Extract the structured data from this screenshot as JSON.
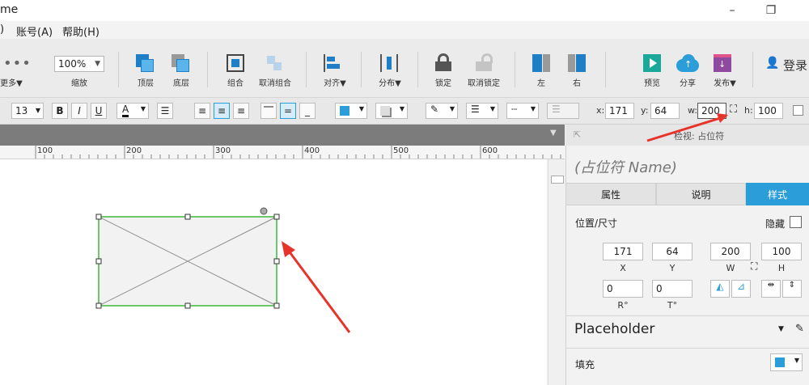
{
  "window": {
    "title": "me",
    "minimize": "–",
    "restore": "❐"
  },
  "menu": {
    "items": [
      "(A) 账号(A)",
      "帮助(H)"
    ],
    "frag": ")",
    "account": "账号(A)",
    "help": "帮助(H)"
  },
  "toolbar": {
    "more": "更多▼",
    "zoom_value": "100%",
    "zoom_label": "缩放",
    "top_layer": "顶层",
    "bottom_layer": "底层",
    "group": "组合",
    "ungroup": "取消组合",
    "align": "对齐▼",
    "distribute": "分布▼",
    "lock": "锁定",
    "unlock": "取消锁定",
    "left": "左",
    "right": "右",
    "preview": "预览",
    "share": "分享",
    "publish": "发布▼",
    "login": "登录"
  },
  "format": {
    "font_size": "13",
    "bold": "B",
    "italic": "I",
    "underline": "U",
    "font_color": "A",
    "x_label": "x:",
    "x": "171",
    "y_label": "y:",
    "y": "64",
    "w_label": "w:",
    "w": "200",
    "h_label": "h:",
    "h": "100"
  },
  "ruler": {
    "ticks": [
      "100",
      "200",
      "300",
      "400",
      "500",
      "600"
    ]
  },
  "panel": {
    "header": "检视: 占位符",
    "name_placeholder": "(占位符 Name)",
    "tabs": [
      "属性",
      "说明",
      "样式"
    ],
    "section_title": "位置/尺寸",
    "hide_label": "隐藏",
    "x": "171",
    "y": "64",
    "w": "200",
    "h": "100",
    "x_lbl": "X",
    "y_lbl": "Y",
    "w_lbl": "W",
    "h_lbl": "H",
    "r": "0",
    "t": "0",
    "r_lbl": "R°",
    "t_lbl": "T°",
    "placeholder_title": "Placeholder",
    "fill_label": "填充"
  },
  "colors": {
    "accent": "#2b9dd8",
    "selection": "#3cb83c",
    "arrow": "#e8332b"
  }
}
